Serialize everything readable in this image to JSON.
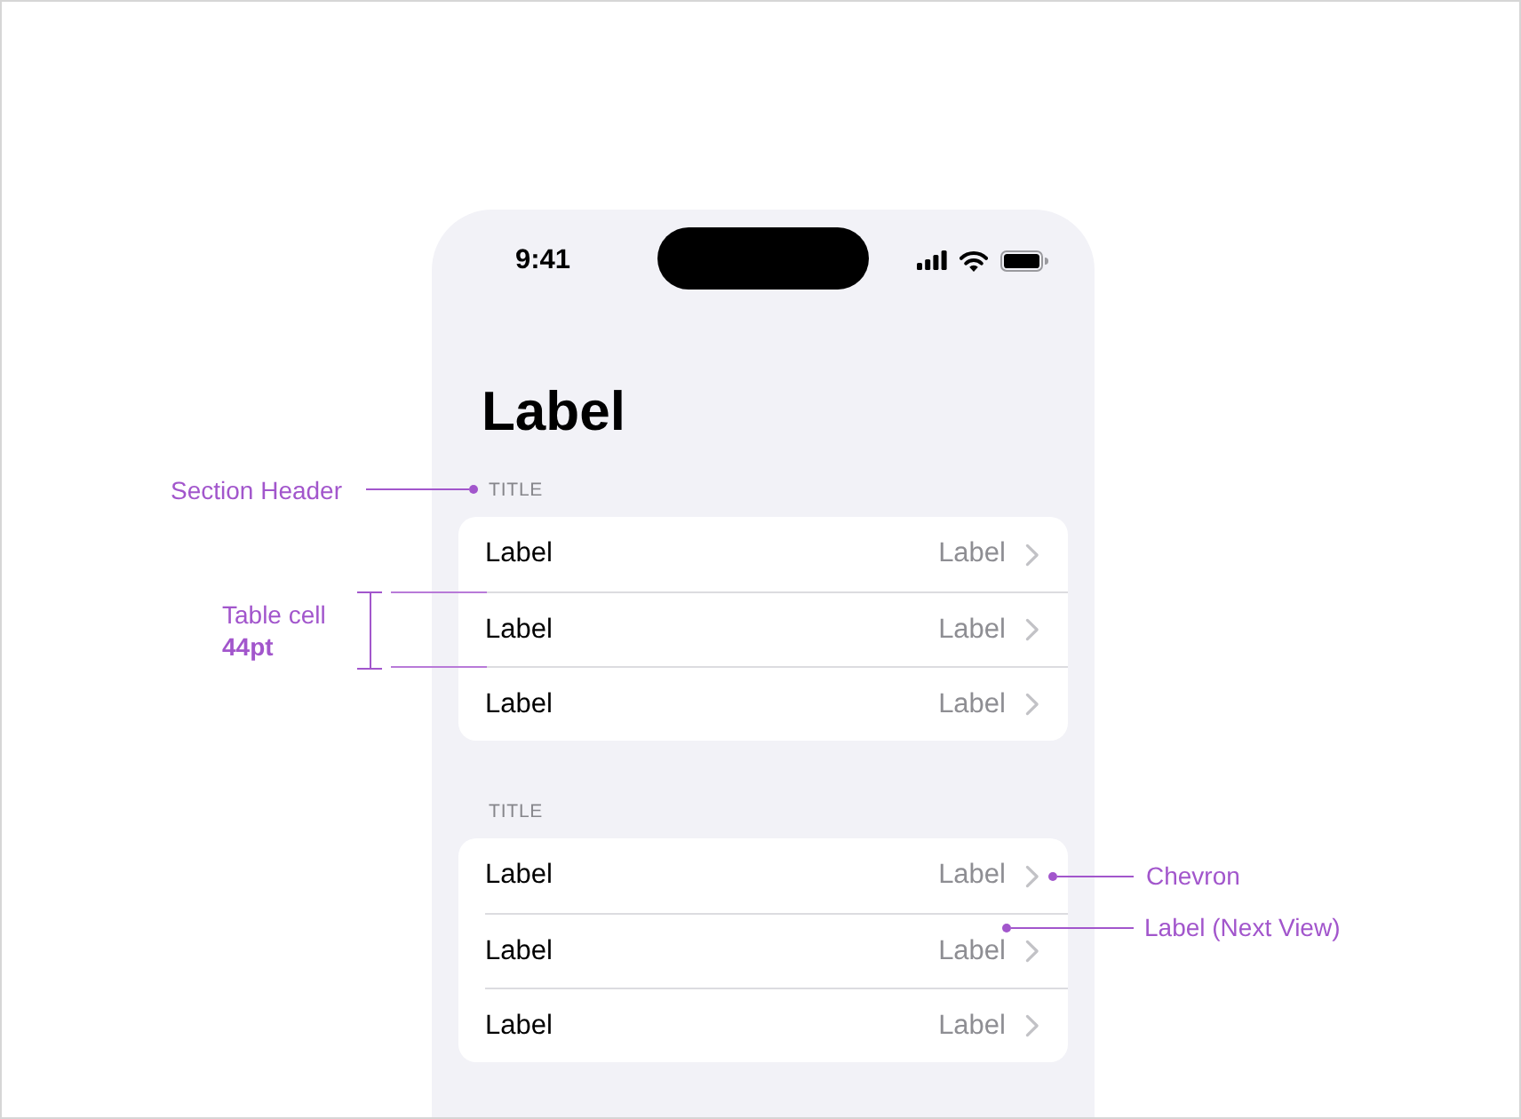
{
  "status_bar": {
    "time": "9:41"
  },
  "large_title": "Label",
  "sections": [
    {
      "header": "TITLE",
      "rows": [
        {
          "label": "Label",
          "detail": "Label"
        },
        {
          "label": "Label",
          "detail": "Label"
        },
        {
          "label": "Label",
          "detail": "Label"
        }
      ]
    },
    {
      "header": "TITLE",
      "rows": [
        {
          "label": "Label",
          "detail": "Label"
        },
        {
          "label": "Label",
          "detail": "Label"
        },
        {
          "label": "Label",
          "detail": "Label"
        }
      ]
    }
  ],
  "annotations": [
    {
      "kind": "section-header",
      "text": "Section Header"
    },
    {
      "kind": "cell-height",
      "text": "Table cell",
      "value": "44pt"
    },
    {
      "kind": "chevron",
      "text": "Chevron"
    },
    {
      "kind": "next-view",
      "text": "Label (Next View)"
    }
  ]
}
